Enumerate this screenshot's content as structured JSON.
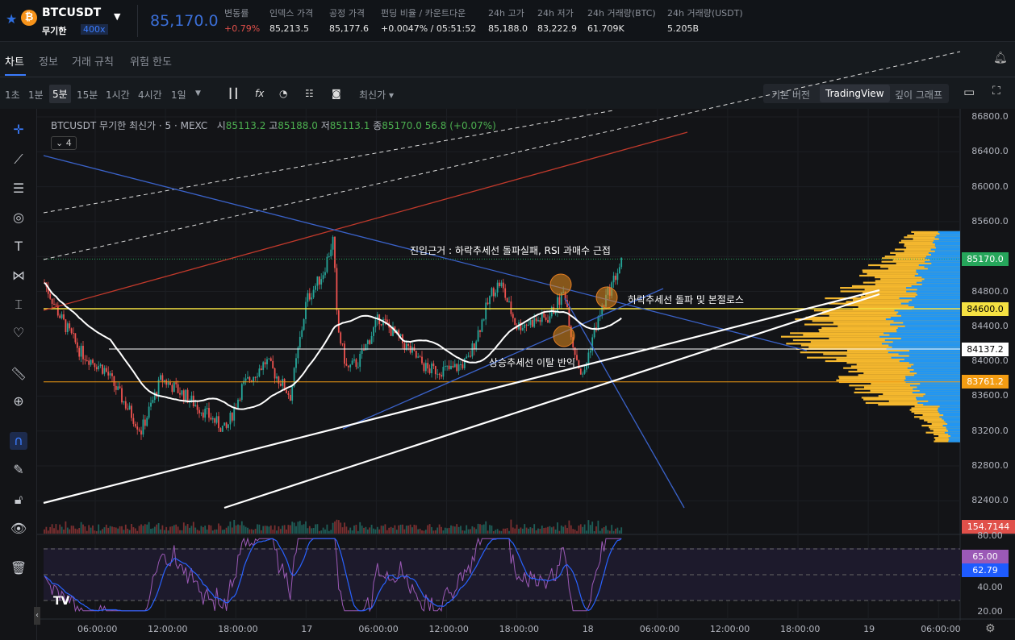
{
  "header": {
    "symbol": "BTCUSDT",
    "contract": "무기한",
    "leverage": "400x",
    "last_price": "85,170.0",
    "stats": [
      {
        "label": "변동률",
        "value": "+0.79%"
      },
      {
        "label": "인덱스 가격",
        "value": "85,213.5"
      },
      {
        "label": "공정 가격",
        "value": "85,177.6"
      },
      {
        "label": "펀딩 비율 / 카운트다운",
        "value": "+0.0047% / 05:51:52"
      },
      {
        "label": "24h 고가",
        "value": "85,188.0"
      },
      {
        "label": "24h 저가",
        "value": "83,222.9"
      },
      {
        "label": "24h 거래량(BTC)",
        "value": "61.709K"
      },
      {
        "label": "24h 거래량(USDT)",
        "value": "5.205B"
      }
    ]
  },
  "tabs": [
    "차트",
    "정보",
    "거래 규칙",
    "위험 한도"
  ],
  "toolbar": {
    "timeframes": [
      "1초",
      "1분",
      "5분",
      "15분",
      "1시간",
      "4시간",
      "1일"
    ],
    "active": "5분",
    "price_type": "최신가",
    "views": [
      "기본 버전",
      "TradingView",
      "깊이 그래프"
    ]
  },
  "legend": {
    "title": "BTCUSDT 무기한 최신가 · 5 · MEXC",
    "o_label": "시",
    "o": "85113.2",
    "h_label": "고",
    "h": "85188.0",
    "l_label": "저",
    "l": "85113.1",
    "c_label": "종",
    "c": "85170.0",
    "change": "56.8 (+0.07%)",
    "collapse": "4"
  },
  "annotations": {
    "entry": "진입근거 : 하락추세선 돌파실패, RSI 과매수 근접",
    "breakout": "하락추세선 돌파 및 본절로스",
    "breakdown": "상승추세선 이탈 반익"
  },
  "price_axis": [
    "86800.0",
    "86400.0",
    "86000.0",
    "85600.0",
    "85200.0",
    "84800.0",
    "84400.0",
    "84000.0",
    "83600.0",
    "83200.0",
    "82800.0",
    "82400.0"
  ],
  "price_tags": [
    {
      "value": "85170.0",
      "color": "#26a65b"
    },
    {
      "value": "84600.0",
      "color": "#f5e142"
    },
    {
      "value": "84137.2",
      "color": "#ffffff"
    },
    {
      "value": "83761.2",
      "color": "#f39c12"
    },
    {
      "value": "154.7144",
      "color": "#e0504a"
    }
  ],
  "rsi_axis": [
    "80.00",
    "40.00",
    "20.00"
  ],
  "rsi_tags": [
    {
      "value": "65.00",
      "color": "#9b59b6"
    },
    {
      "value": "62.79",
      "color": "#1e5bff"
    }
  ],
  "time_axis": [
    "06:00:00",
    "12:00:00",
    "18:00:00",
    "17",
    "06:00:00",
    "12:00:00",
    "18:00:00",
    "18",
    "06:00:00",
    "12:00:00",
    "18:00:00",
    "19",
    "06:00:00"
  ],
  "chart_data": {
    "type": "candlestick",
    "price_path": [
      84900,
      84500,
      84100,
      83900,
      83200,
      83800,
      83600,
      83200,
      83700,
      84000,
      83600,
      84700,
      85000,
      85400,
      84400,
      83900,
      84000,
      84500,
      84200,
      83900,
      83900,
      84000,
      84800,
      84900,
      84400,
      84500,
      84800,
      84200,
      83800,
      84300,
      84700,
      85170
    ],
    "hlines": [
      84600,
      84137.2,
      83761.2
    ]
  }
}
